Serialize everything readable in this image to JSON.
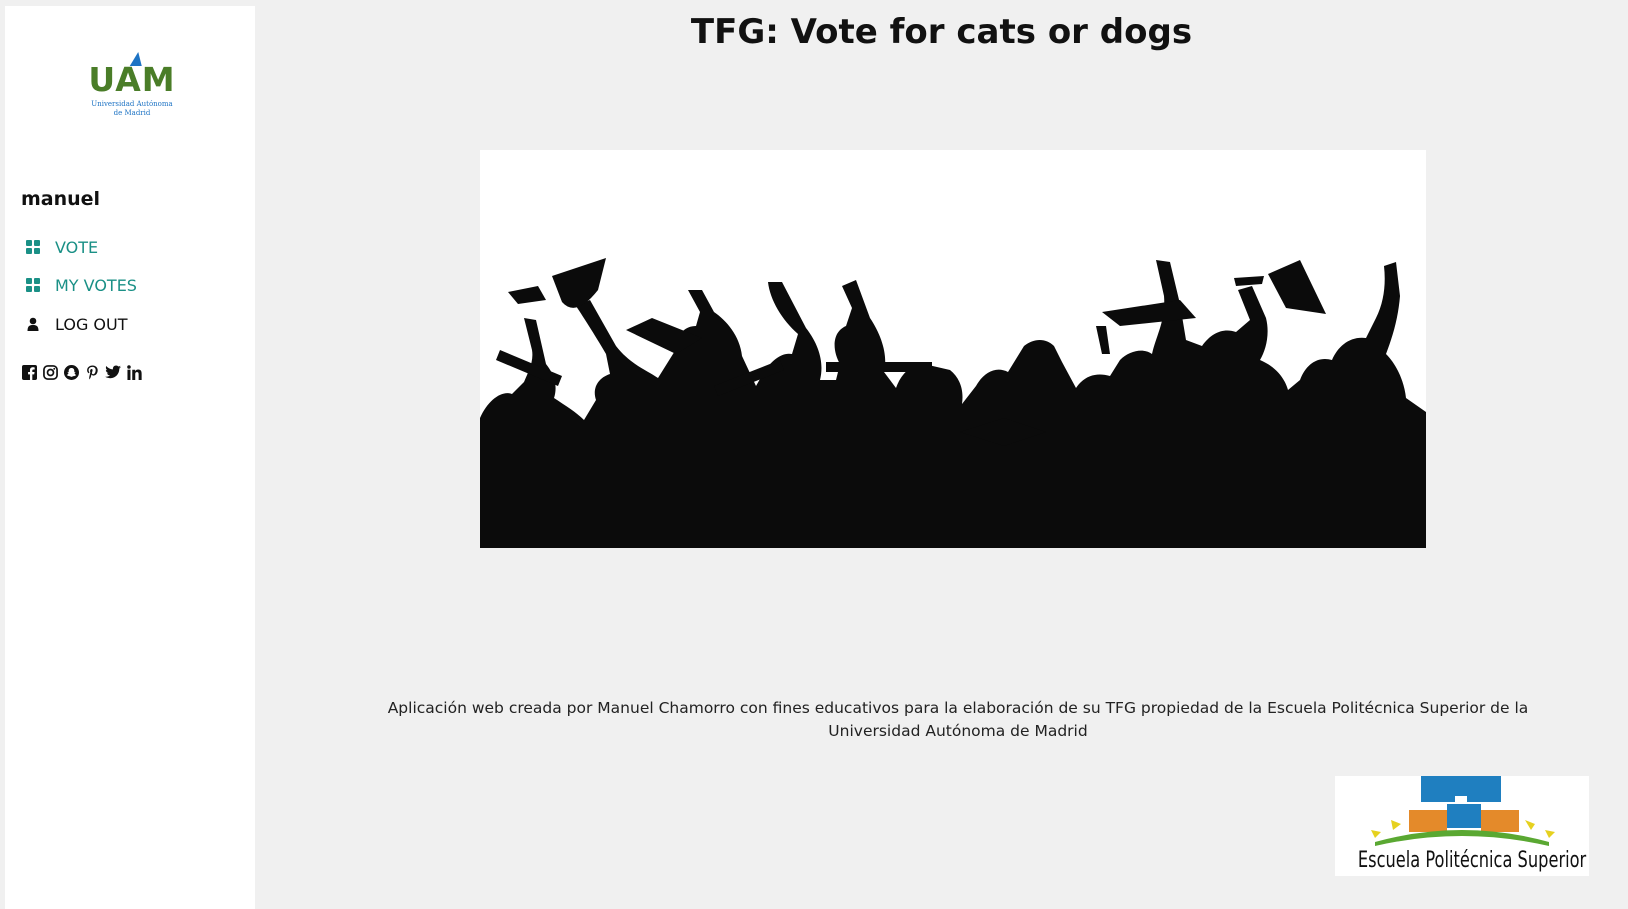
{
  "page": {
    "title": "TFG: Vote for cats or dogs",
    "footer_text": "Aplicación web creada por Manuel Chamorro con fines educativos para la elaboración de su TFG propiedad de la Escuela Politécnica Superior de la Universidad Autónoma de Madrid"
  },
  "sidebar": {
    "logo": {
      "letters": "UAM",
      "subtitle_line1": "Universidad Autónoma",
      "subtitle_line2": "de Madrid"
    },
    "username": "manuel",
    "nav": [
      {
        "label": "VOTE",
        "icon": "grid-icon"
      },
      {
        "label": "MY VOTES",
        "icon": "grid-icon"
      },
      {
        "label": "LOG OUT",
        "icon": "user-icon"
      }
    ],
    "socials": [
      "facebook-icon",
      "instagram-icon",
      "snapchat-icon",
      "pinterest-icon",
      "twitter-icon",
      "linkedin-icon"
    ]
  },
  "footer_logo": {
    "text": "Escuela Politécnica Superior"
  },
  "colors": {
    "accent": "#1a9086",
    "uam_green": "#4a7d28",
    "uam_blue": "#1d73c4",
    "page_bg": "#f0f0f0"
  }
}
